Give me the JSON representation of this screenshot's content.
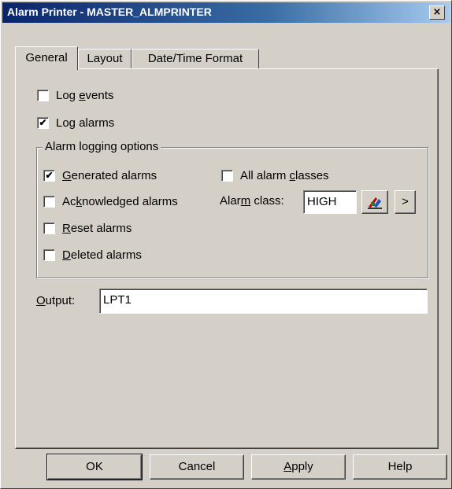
{
  "window": {
    "title": "Alarm Printer - MASTER_ALMPRINTER",
    "close_glyph": "×"
  },
  "tabs": [
    {
      "label": "General",
      "active": true
    },
    {
      "label": "Layout",
      "active": false
    },
    {
      "label": "Date/Time Format",
      "active": false
    }
  ],
  "options": {
    "log_events": {
      "pre": "Log ",
      "mn": "e",
      "post": "vents",
      "checked": false
    },
    "log_alarms": {
      "pre": "Log alarms",
      "mn": "",
      "post": "",
      "checked": true
    }
  },
  "group": {
    "title": "Alarm logging options",
    "generated": {
      "pre": "",
      "mn": "G",
      "post": "enerated alarms",
      "checked": true
    },
    "acknowledged": {
      "pre": "Ac",
      "mn": "k",
      "post": "nowledged alarms",
      "checked": false
    },
    "reset": {
      "pre": "",
      "mn": "R",
      "post": "eset alarms",
      "checked": false
    },
    "deleted": {
      "pre": "",
      "mn": "D",
      "post": "eleted alarms",
      "checked": false
    },
    "all_classes": {
      "pre": "All alarm ",
      "mn": "c",
      "post": "lasses",
      "checked": false
    },
    "alarm_class": {
      "pre": "Alar",
      "mn": "m",
      "post": " class:",
      "value": "HIGH",
      "browse_glyph": ">"
    }
  },
  "output": {
    "pre": "",
    "mn": "O",
    "post": "utput:",
    "value": "LPT1"
  },
  "buttons": {
    "ok": "OK",
    "cancel": "Cancel",
    "apply": {
      "pre": "",
      "mn": "A",
      "post": "pply"
    },
    "help": "Help"
  },
  "icons": {
    "alarm_class_picker": "alarm-class-picker-icon"
  },
  "colors": {
    "titlebar_start": "#0a246a",
    "titlebar_end": "#a6caf0",
    "face": "#d4d0c8"
  }
}
